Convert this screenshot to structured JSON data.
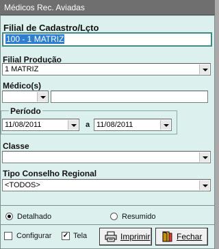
{
  "window": {
    "title": "Médicos Rec. Aviadas"
  },
  "filial_cadastro": {
    "label": "Filial de Cadastro/Lçto",
    "value": "100 - 1 MATRIZ"
  },
  "filial_producao": {
    "label": "Filial Produção",
    "value": "1 MATRIZ"
  },
  "medicos": {
    "label": "Médico(s)",
    "code": "",
    "name": ""
  },
  "periodo": {
    "label": "Período",
    "start": "11/08/2011",
    "sep": "a",
    "end": "11/08/2011"
  },
  "classe": {
    "label": "Classe",
    "value": ""
  },
  "conselho": {
    "label": "Tipo Conselho Regional",
    "value": "<TODOS>"
  },
  "report_type": {
    "detalhado": "Detalhado",
    "resumido": "Resumido",
    "selected": "Detalhado"
  },
  "options": {
    "configurar": "Configurar",
    "configurar_checked": false,
    "tela": "Tela",
    "tela_checked": true
  },
  "buttons": {
    "imprimir": "Imprimir",
    "fechar": "Fechar"
  }
}
